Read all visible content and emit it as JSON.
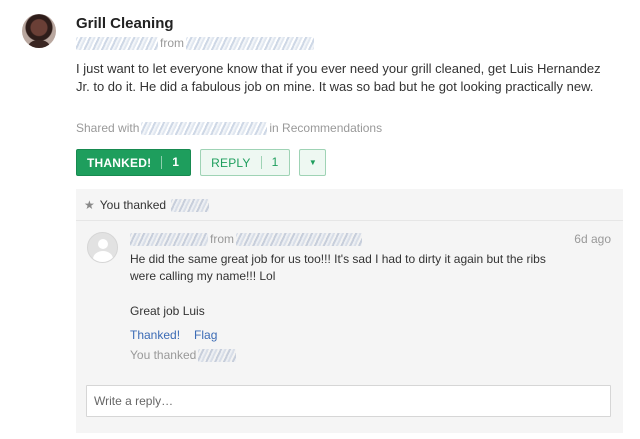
{
  "post": {
    "title": "Grill Cleaning",
    "meta_from": "from",
    "body": "I just want to let everyone know that if you ever need your grill cleaned, get Luis Hernandez Jr. to do it. He did a fabulous job on mine. It was so bad but he got looking practically new.",
    "shared_prefix": "Shared with",
    "shared_suffix": "in Recommendations"
  },
  "actions": {
    "thanked_label": "THANKED!",
    "thanked_count": "1",
    "reply_label": "REPLY",
    "reply_count": "1",
    "more_icon": "▼"
  },
  "thread": {
    "thanks_icon": "★",
    "thanks_text": "You thanked",
    "comment": {
      "from": "from",
      "time": "6d ago",
      "text": "He did the same great job for us too!!! It's sad I had to dirty it again but the ribs were calling my name!!! Lol",
      "text2": "Great job Luis",
      "thanked_link": "Thanked!",
      "flag_link": "Flag",
      "you_thanked": "You thanked"
    },
    "reply_placeholder": "Write a reply…"
  }
}
